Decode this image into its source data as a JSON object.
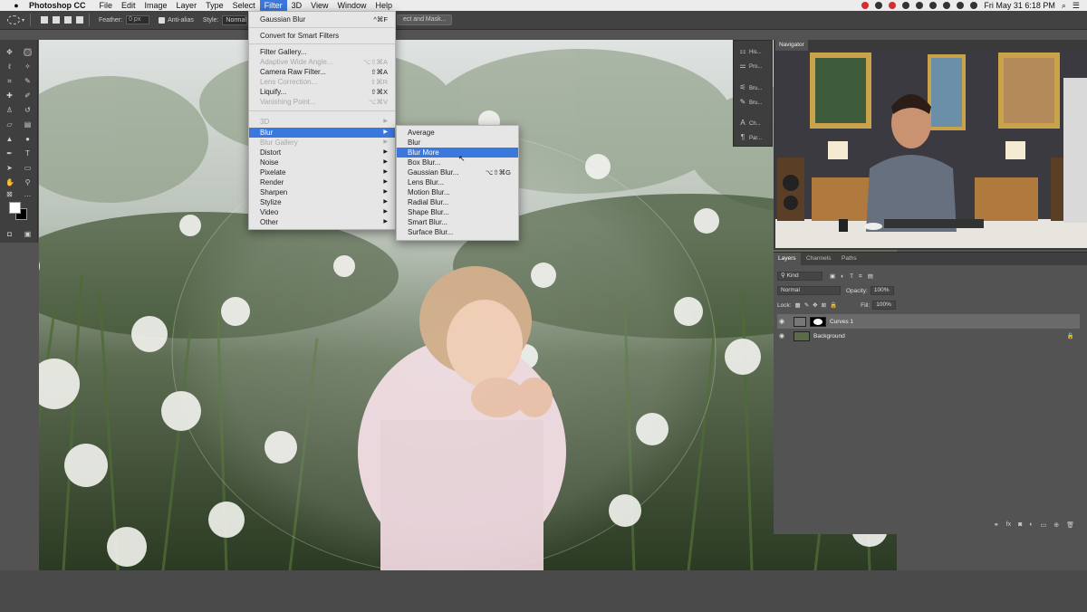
{
  "menubar": {
    "app_name": "Photoshop CC",
    "items": [
      "File",
      "Edit",
      "Image",
      "Layer",
      "Type",
      "Select",
      "Filter",
      "3D",
      "View",
      "Window",
      "Help"
    ],
    "active": "Filter",
    "clock": "Fri May 31  6:18 PM"
  },
  "options": {
    "feather_label": "Feather:",
    "feather_value": "0 px",
    "antialias_label": "Anti-alias",
    "style_label": "Style:",
    "style_value": "Normal",
    "select_mask_label": "ect and Mask..."
  },
  "filter_menu": {
    "last_filter": {
      "label": "Gaussian Blur",
      "shortcut": "^⌘F"
    },
    "convert": "Convert for Smart Filters",
    "filter_gallery": "Filter Gallery...",
    "adaptive": {
      "label": "Adaptive Wide Angle...",
      "shortcut": "⌥⇧⌘A"
    },
    "camera_raw": {
      "label": "Camera Raw Filter...",
      "shortcut": "⇧⌘A"
    },
    "lens_correction": {
      "label": "Lens Correction...",
      "shortcut": "⇧⌘R"
    },
    "liquify": {
      "label": "Liquify...",
      "shortcut": "⇧⌘X"
    },
    "vanishing": {
      "label": "Vanishing Point...",
      "shortcut": "⌥⌘V"
    },
    "threed": "3D",
    "blur": "Blur",
    "blur_gallery": "Blur Gallery",
    "distort": "Distort",
    "noise": "Noise",
    "pixelate": "Pixelate",
    "render": "Render",
    "sharpen": "Sharpen",
    "stylize": "Stylize",
    "video": "Video",
    "other": "Other"
  },
  "blur_menu": {
    "average": "Average",
    "blur": "Blur",
    "blur_more": "Blur More",
    "box": "Box Blur...",
    "gaussian": {
      "label": "Gaussian Blur...",
      "shortcut": "⌥⇧⌘G"
    },
    "lens": "Lens Blur...",
    "motion": "Motion Blur...",
    "radial": "Radial Blur...",
    "shape": "Shape Blur...",
    "smart": "Smart Blur...",
    "surface": "Surface Blur..."
  },
  "dock": {
    "history": "His...",
    "properties": "Pro...",
    "brush": "Bru...",
    "brush2": "Bru...",
    "character": "Ch...",
    "paragraph": "Par..."
  },
  "navigator_tab": "Navigator",
  "layers": {
    "tabs": {
      "layers": "Layers",
      "channels": "Channels",
      "paths": "Paths"
    },
    "kind": "Kind",
    "blend": "Normal",
    "opacity_label": "Opacity:",
    "opacity_value": "100%",
    "lock_label": "Lock:",
    "fill_label": "Fill:",
    "fill_value": "100%",
    "items": [
      "Curves 1",
      "Background"
    ]
  },
  "colors": {
    "accent": "#3b78de",
    "panel": "#535353",
    "menu_bg": "#e6e6e6"
  }
}
